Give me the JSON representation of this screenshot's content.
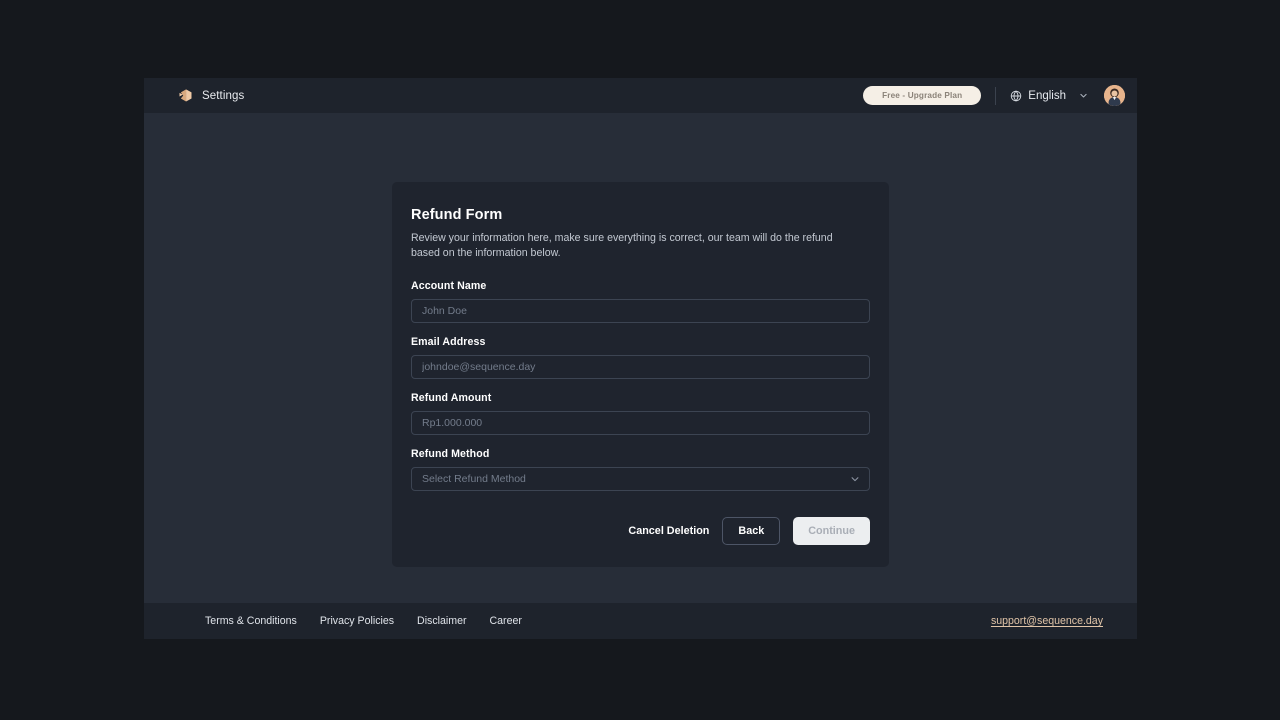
{
  "topbar": {
    "logo_icon": "sequence-logo-icon",
    "title": "Settings",
    "plan_badge": "Free - Upgrade Plan",
    "globe_icon": "globe-icon",
    "language": "English",
    "chevron_icon": "chevron-down-icon",
    "avatar_icon": "user-avatar"
  },
  "card": {
    "title": "Refund Form",
    "subtitle": "Review your information here, make sure everything is correct, our team will do the refund based on the information below.",
    "fields": [
      {
        "label": "Account Name",
        "value": "",
        "placeholder": "John Doe",
        "type": "text"
      },
      {
        "label": "Email Address",
        "value": "",
        "placeholder": "johndoe@sequence.day",
        "type": "email"
      },
      {
        "label": "Refund Amount",
        "value": "",
        "placeholder": "Rp1.000.000",
        "type": "text"
      },
      {
        "label": "Refund Method",
        "value": "",
        "placeholder": "Select Refund Method",
        "type": "select"
      }
    ],
    "actions": {
      "cancel_label": "Cancel Deletion",
      "back_label": "Back",
      "continue_label": "Continue",
      "continue_disabled": true
    }
  },
  "footer": {
    "links": [
      {
        "label": "Terms & Conditions"
      },
      {
        "label": "Privacy Policies"
      },
      {
        "label": "Disclaimer"
      },
      {
        "label": "Career"
      }
    ],
    "support_email": "support@sequence.day"
  },
  "colors": {
    "page_background": "#15181d",
    "app_background": "#272d38",
    "bar_background": "#1e232c",
    "card_background": "#1f242e",
    "accent_cream": "#f5efe6",
    "accent_tan": "#e0c4a8",
    "input_border": "#3c4452",
    "text_primary": "#ffffff",
    "text_muted": "#737c8b"
  }
}
